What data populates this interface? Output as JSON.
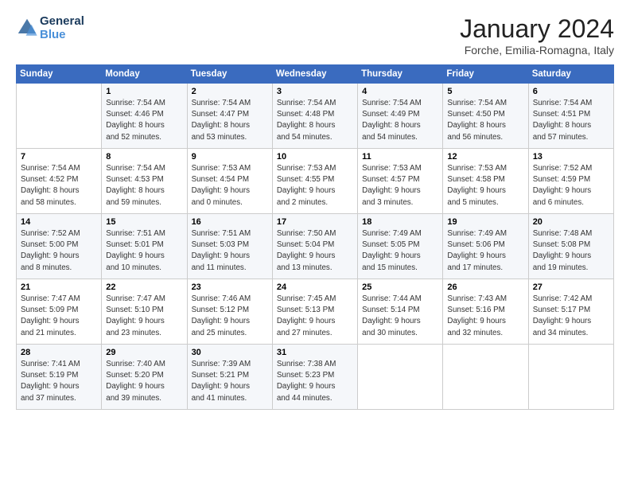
{
  "logo": {
    "line1": "General",
    "line2": "Blue"
  },
  "title": "January 2024",
  "location": "Forche, Emilia-Romagna, Italy",
  "days_header": [
    "Sunday",
    "Monday",
    "Tuesday",
    "Wednesday",
    "Thursday",
    "Friday",
    "Saturday"
  ],
  "weeks": [
    [
      {
        "num": "",
        "info": ""
      },
      {
        "num": "1",
        "info": "Sunrise: 7:54 AM\nSunset: 4:46 PM\nDaylight: 8 hours\nand 52 minutes."
      },
      {
        "num": "2",
        "info": "Sunrise: 7:54 AM\nSunset: 4:47 PM\nDaylight: 8 hours\nand 53 minutes."
      },
      {
        "num": "3",
        "info": "Sunrise: 7:54 AM\nSunset: 4:48 PM\nDaylight: 8 hours\nand 54 minutes."
      },
      {
        "num": "4",
        "info": "Sunrise: 7:54 AM\nSunset: 4:49 PM\nDaylight: 8 hours\nand 54 minutes."
      },
      {
        "num": "5",
        "info": "Sunrise: 7:54 AM\nSunset: 4:50 PM\nDaylight: 8 hours\nand 56 minutes."
      },
      {
        "num": "6",
        "info": "Sunrise: 7:54 AM\nSunset: 4:51 PM\nDaylight: 8 hours\nand 57 minutes."
      }
    ],
    [
      {
        "num": "7",
        "info": "Sunrise: 7:54 AM\nSunset: 4:52 PM\nDaylight: 8 hours\nand 58 minutes."
      },
      {
        "num": "8",
        "info": "Sunrise: 7:54 AM\nSunset: 4:53 PM\nDaylight: 8 hours\nand 59 minutes."
      },
      {
        "num": "9",
        "info": "Sunrise: 7:53 AM\nSunset: 4:54 PM\nDaylight: 9 hours\nand 0 minutes."
      },
      {
        "num": "10",
        "info": "Sunrise: 7:53 AM\nSunset: 4:55 PM\nDaylight: 9 hours\nand 2 minutes."
      },
      {
        "num": "11",
        "info": "Sunrise: 7:53 AM\nSunset: 4:57 PM\nDaylight: 9 hours\nand 3 minutes."
      },
      {
        "num": "12",
        "info": "Sunrise: 7:53 AM\nSunset: 4:58 PM\nDaylight: 9 hours\nand 5 minutes."
      },
      {
        "num": "13",
        "info": "Sunrise: 7:52 AM\nSunset: 4:59 PM\nDaylight: 9 hours\nand 6 minutes."
      }
    ],
    [
      {
        "num": "14",
        "info": "Sunrise: 7:52 AM\nSunset: 5:00 PM\nDaylight: 9 hours\nand 8 minutes."
      },
      {
        "num": "15",
        "info": "Sunrise: 7:51 AM\nSunset: 5:01 PM\nDaylight: 9 hours\nand 10 minutes."
      },
      {
        "num": "16",
        "info": "Sunrise: 7:51 AM\nSunset: 5:03 PM\nDaylight: 9 hours\nand 11 minutes."
      },
      {
        "num": "17",
        "info": "Sunrise: 7:50 AM\nSunset: 5:04 PM\nDaylight: 9 hours\nand 13 minutes."
      },
      {
        "num": "18",
        "info": "Sunrise: 7:49 AM\nSunset: 5:05 PM\nDaylight: 9 hours\nand 15 minutes."
      },
      {
        "num": "19",
        "info": "Sunrise: 7:49 AM\nSunset: 5:06 PM\nDaylight: 9 hours\nand 17 minutes."
      },
      {
        "num": "20",
        "info": "Sunrise: 7:48 AM\nSunset: 5:08 PM\nDaylight: 9 hours\nand 19 minutes."
      }
    ],
    [
      {
        "num": "21",
        "info": "Sunrise: 7:47 AM\nSunset: 5:09 PM\nDaylight: 9 hours\nand 21 minutes."
      },
      {
        "num": "22",
        "info": "Sunrise: 7:47 AM\nSunset: 5:10 PM\nDaylight: 9 hours\nand 23 minutes."
      },
      {
        "num": "23",
        "info": "Sunrise: 7:46 AM\nSunset: 5:12 PM\nDaylight: 9 hours\nand 25 minutes."
      },
      {
        "num": "24",
        "info": "Sunrise: 7:45 AM\nSunset: 5:13 PM\nDaylight: 9 hours\nand 27 minutes."
      },
      {
        "num": "25",
        "info": "Sunrise: 7:44 AM\nSunset: 5:14 PM\nDaylight: 9 hours\nand 30 minutes."
      },
      {
        "num": "26",
        "info": "Sunrise: 7:43 AM\nSunset: 5:16 PM\nDaylight: 9 hours\nand 32 minutes."
      },
      {
        "num": "27",
        "info": "Sunrise: 7:42 AM\nSunset: 5:17 PM\nDaylight: 9 hours\nand 34 minutes."
      }
    ],
    [
      {
        "num": "28",
        "info": "Sunrise: 7:41 AM\nSunset: 5:19 PM\nDaylight: 9 hours\nand 37 minutes."
      },
      {
        "num": "29",
        "info": "Sunrise: 7:40 AM\nSunset: 5:20 PM\nDaylight: 9 hours\nand 39 minutes."
      },
      {
        "num": "30",
        "info": "Sunrise: 7:39 AM\nSunset: 5:21 PM\nDaylight: 9 hours\nand 41 minutes."
      },
      {
        "num": "31",
        "info": "Sunrise: 7:38 AM\nSunset: 5:23 PM\nDaylight: 9 hours\nand 44 minutes."
      },
      {
        "num": "",
        "info": ""
      },
      {
        "num": "",
        "info": ""
      },
      {
        "num": "",
        "info": ""
      }
    ]
  ]
}
